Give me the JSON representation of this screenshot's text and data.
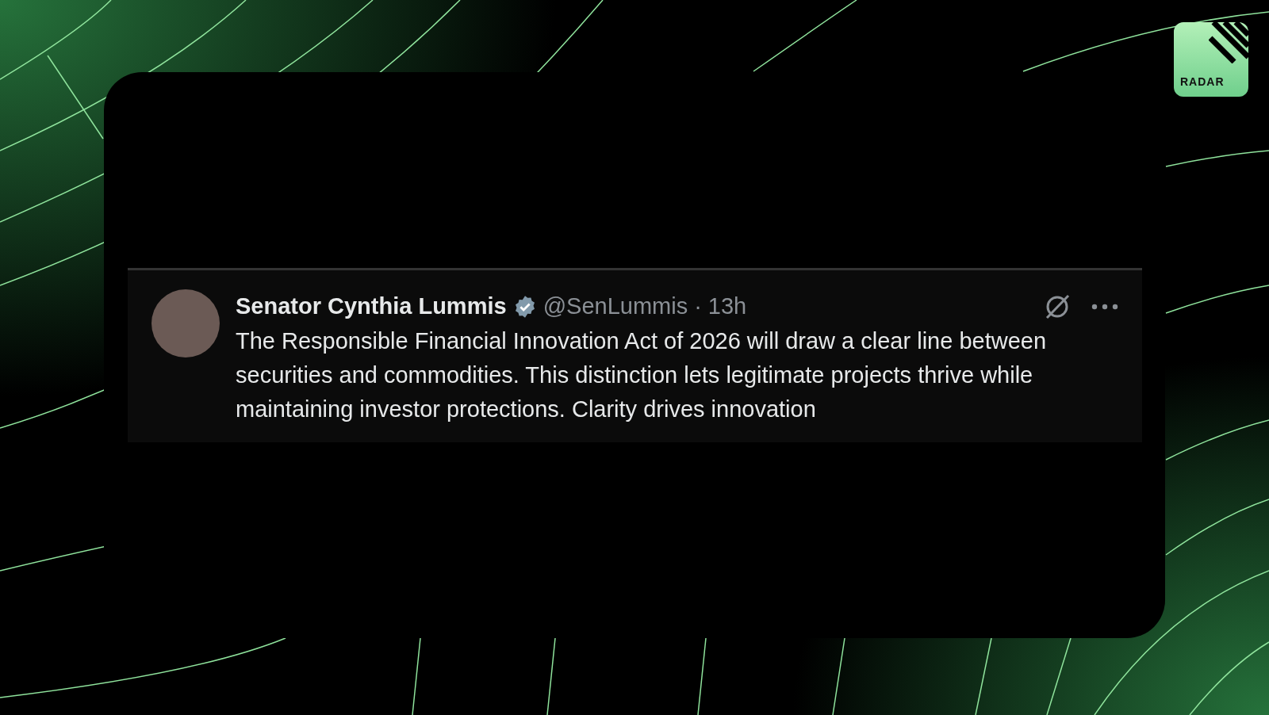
{
  "logo": {
    "label": "RADAR"
  },
  "post": {
    "author": "Senator Cynthia Lummis",
    "verified": true,
    "handle": "@SenLummis",
    "separator": "·",
    "time": "13h",
    "text": "The Responsible Financial Innovation Act of 2026 will draw a clear line between securities and commodities. This distinction lets legitimate projects thrive while maintaining investor protections. Clarity drives innovation"
  }
}
